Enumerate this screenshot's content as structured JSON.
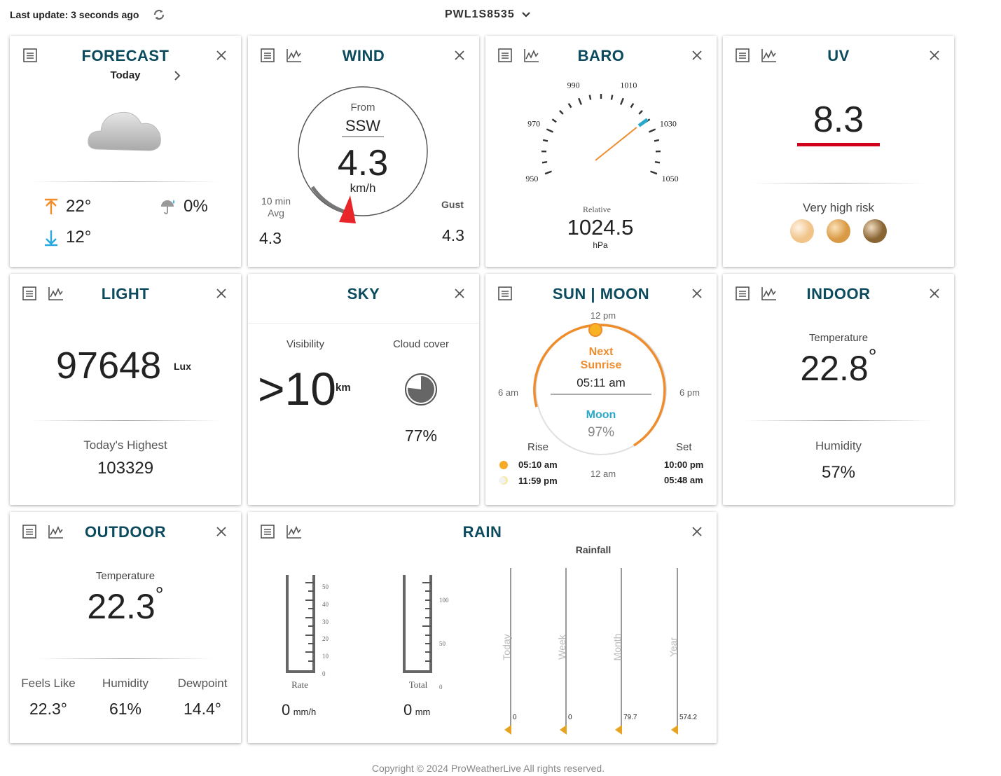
{
  "header": {
    "last_update": "Last update: 3 seconds ago",
    "station": "PWL1S8535"
  },
  "forecast": {
    "title": "FORECAST",
    "day": "Today",
    "high": "22°",
    "low": "12°",
    "precip": "0%"
  },
  "wind": {
    "title": "WIND",
    "from_label": "From",
    "direction": "SSW",
    "speed": "4.3",
    "unit": "km/h",
    "avg_label_1": "10 min",
    "avg_label_2": "Avg",
    "avg_value": "4.3",
    "gust_label": "Gust",
    "gust_value": "4.3"
  },
  "baro": {
    "title": "BARO",
    "ticks": [
      "950",
      "970",
      "990",
      "1010",
      "1030",
      "1050"
    ],
    "label": "Relative",
    "value": "1024.5",
    "unit": "hPa",
    "needle_value": 1024.5
  },
  "uv": {
    "title": "UV",
    "value": "8.3",
    "risk": "Very high risk",
    "accent": "#d0021b"
  },
  "light": {
    "title": "LIGHT",
    "value": "97648",
    "unit": "Lux",
    "highest_label": "Today's Highest",
    "highest_value": "103329"
  },
  "sky": {
    "title": "SKY",
    "visibility_label": "Visibility",
    "visibility_value": ">10",
    "visibility_unit": "km",
    "cloud_label": "Cloud cover",
    "cloud_value": "77%",
    "cloud_fraction": 0.77
  },
  "sunmoon": {
    "title": "SUN | MOON",
    "t12pm": "12 pm",
    "t6am": "6 am",
    "t6pm": "6 pm",
    "t12am": "12 am",
    "next_label_1": "Next",
    "next_label_2": "Sunrise",
    "next_time": "05:11 am",
    "moon_label": "Moon",
    "moon_pct": "97%",
    "rise_label": "Rise",
    "set_label": "Set",
    "sun_rise": "05:10 am",
    "moon_rise": "11:59 pm",
    "sun_set": "10:00 pm",
    "moon_set": "05:48 am"
  },
  "indoor": {
    "title": "INDOOR",
    "temp_label": "Temperature",
    "temp_value": "22.8",
    "deg": "°",
    "hum_label": "Humidity",
    "hum_value": "57%"
  },
  "outdoor": {
    "title": "OUTDOOR",
    "temp_label": "Temperature",
    "temp_value": "22.3",
    "deg": "°",
    "feels_label": "Feels Like",
    "feels_value": "22.3°",
    "hum_label": "Humidity",
    "hum_value": "61%",
    "dew_label": "Dewpoint",
    "dew_value": "14.4°"
  },
  "rain": {
    "title": "RAIN",
    "rainfall_label": "Rainfall",
    "rate_label": "Rate",
    "rate_value": "0",
    "rate_unit": "mm/h",
    "rate_ticks": [
      "50",
      "40",
      "30",
      "20",
      "10",
      "0"
    ],
    "total_label": "Total",
    "total_value": "0",
    "total_unit": "mm",
    "total_ticks": [
      "100",
      "50",
      "0"
    ],
    "periods": [
      {
        "label": "Today",
        "value": "0"
      },
      {
        "label": "Week",
        "value": "0"
      },
      {
        "label": "Month",
        "value": "79.7"
      },
      {
        "label": "Year",
        "value": "574.2"
      }
    ]
  },
  "footer": "Copyright © 2024 ProWeatherLive All rights reserved."
}
